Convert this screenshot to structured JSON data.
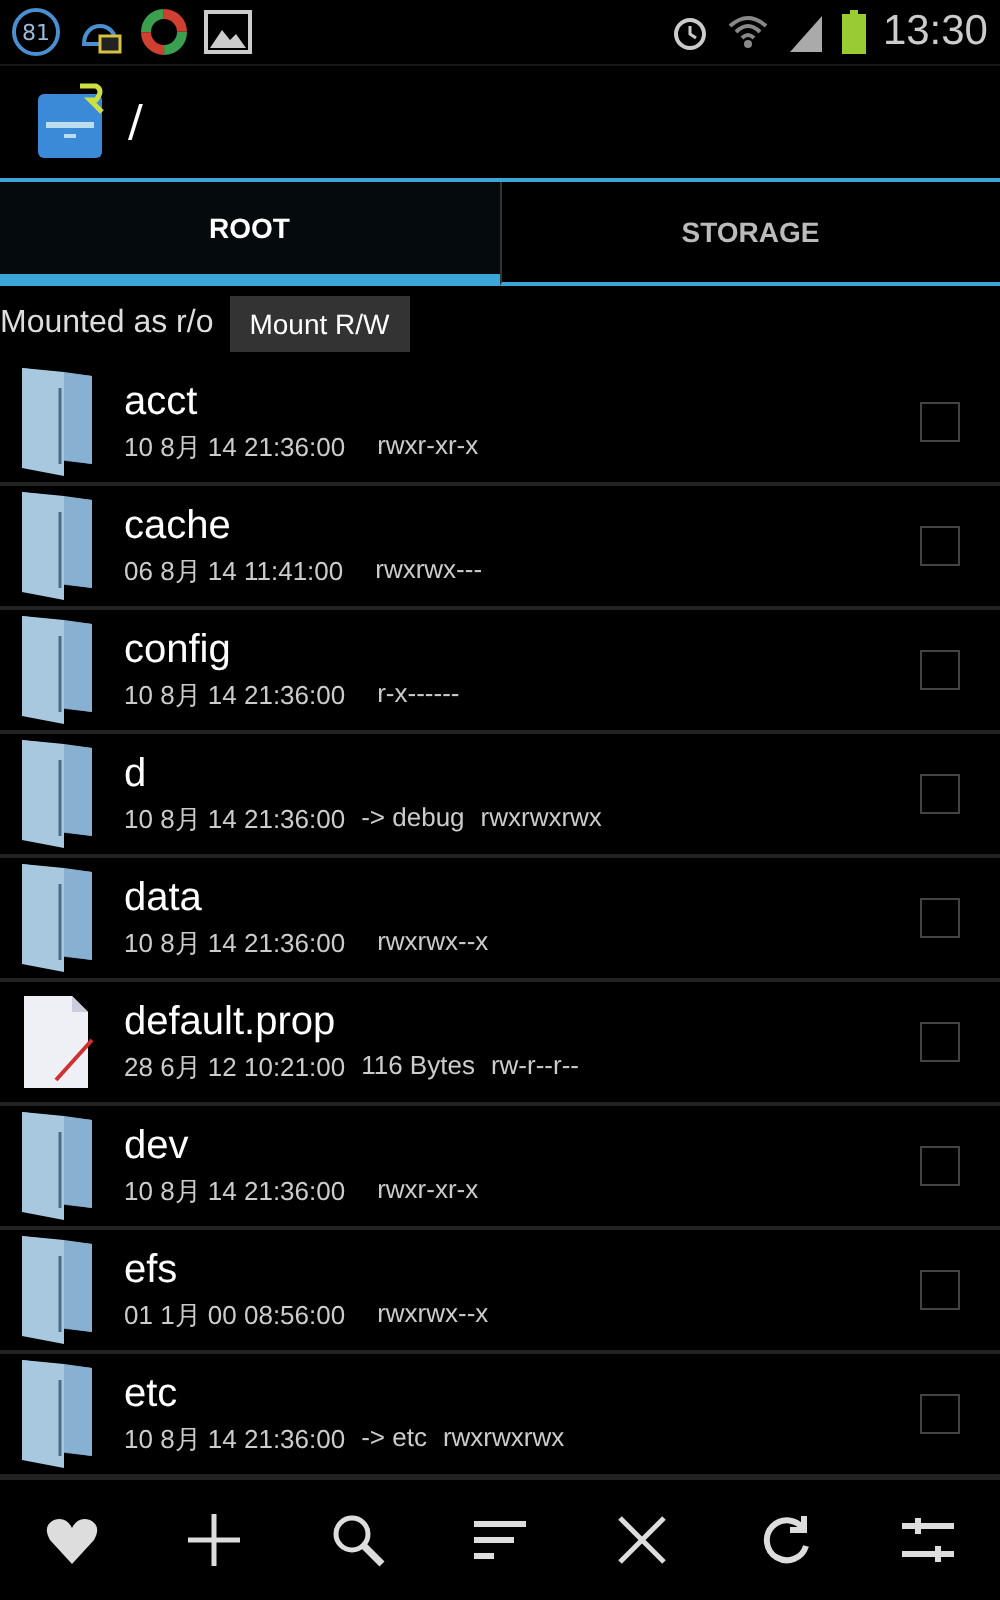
{
  "status_bar": {
    "badge": "81",
    "time": "13:30"
  },
  "title_bar": {
    "path": "/"
  },
  "tabs": [
    {
      "label": "ROOT",
      "selected": true
    },
    {
      "label": "STORAGE",
      "selected": false
    }
  ],
  "mount": {
    "status": "Mounted as r/o",
    "button": "Mount R/W"
  },
  "files": [
    {
      "kind": "folder",
      "name": "acct",
      "date": "10 8月 14 21:36:00",
      "perms": "rwxr-xr-x",
      "checked": false
    },
    {
      "kind": "folder",
      "name": "cache",
      "date": "06 8月 14 11:41:00",
      "perms": "rwxrwx---",
      "checked": false
    },
    {
      "kind": "folder",
      "name": "config",
      "date": "10 8月 14 21:36:00",
      "perms": "r-x------",
      "checked": false
    },
    {
      "kind": "folder",
      "name": "d",
      "date": "10 8月 14 21:36:00",
      "info": "-> debug",
      "perms": "rwxrwxrwx",
      "checked": false
    },
    {
      "kind": "folder",
      "name": "data",
      "date": "10 8月 14 21:36:00",
      "perms": "rwxrwx--x",
      "checked": false
    },
    {
      "kind": "file",
      "name": "default.prop",
      "date": "28 6月 12 10:21:00",
      "info": "116 Bytes",
      "perms": "rw-r--r--",
      "checked": false
    },
    {
      "kind": "folder",
      "name": "dev",
      "date": "10 8月 14 21:36:00",
      "perms": "rwxr-xr-x",
      "checked": false
    },
    {
      "kind": "folder",
      "name": "efs",
      "date": "01 1月 00 08:56:00",
      "perms": "rwxrwx--x",
      "checked": false
    },
    {
      "kind": "folder",
      "name": "etc",
      "date": "10 8月 14 21:36:00",
      "info": "-> etc",
      "perms": "rwxrwxrwx",
      "checked": false
    }
  ],
  "toolbar": [
    {
      "kind": "favorite"
    },
    {
      "kind": "add"
    },
    {
      "kind": "search"
    },
    {
      "kind": "sort"
    },
    {
      "kind": "close"
    },
    {
      "kind": "refresh"
    },
    {
      "kind": "settings"
    }
  ]
}
